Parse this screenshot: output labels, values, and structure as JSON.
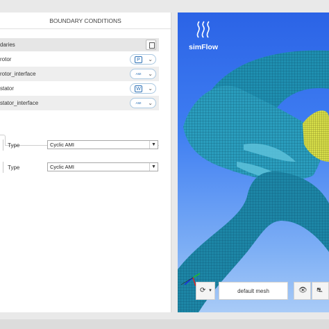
{
  "panel": {
    "title": "BOUNDARY CONDITIONS",
    "boundaries_header": "daries",
    "boundaries": [
      {
        "name": "rotor",
        "type_glyph": "P",
        "type_icon": "patch-icon"
      },
      {
        "name": "rotor_interface",
        "type_glyph": "AMI",
        "type_icon": "ami-icon"
      },
      {
        "name": "stator",
        "type_glyph": "W",
        "type_icon": "wall-icon"
      },
      {
        "name": "stator_interface",
        "type_glyph": "AMI",
        "type_icon": "ami-icon"
      }
    ],
    "fields": [
      {
        "label": "Type",
        "value": "Cyclic AMI"
      },
      {
        "label": "Type",
        "value": "Cyclic AMI"
      }
    ]
  },
  "viewport": {
    "brand": "simFlow",
    "mesh_selector": "default mesh",
    "colors": {
      "background_top": "#2b63e6",
      "mesh": "#1f8fb0",
      "highlight": "#d8e04a"
    }
  }
}
